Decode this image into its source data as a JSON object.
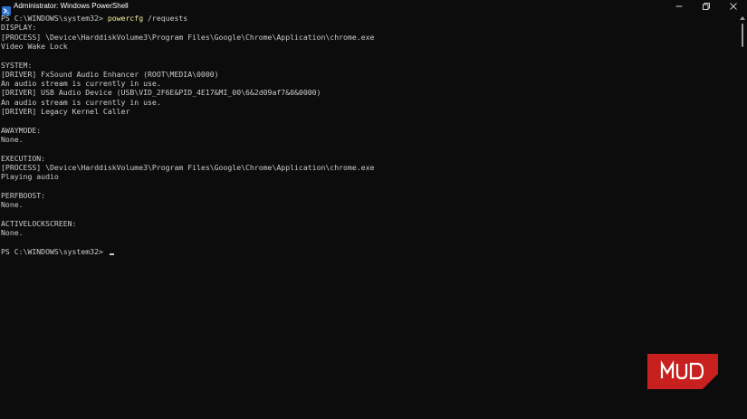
{
  "window": {
    "title": "Administrator: Windows PowerShell",
    "controls": {
      "minimize_icon": "minimize-icon",
      "maximize_icon": "restore-icon",
      "close_icon": "close-icon"
    }
  },
  "terminal": {
    "prompt": "PS C:\\WINDOWS\\system32> ",
    "command": "powercfg",
    "command_args": " /requests",
    "lines": [
      "DISPLAY:",
      "[PROCESS] \\Device\\HarddiskVolume3\\Program Files\\Google\\Chrome\\Application\\chrome.exe",
      "Video Wake Lock",
      "",
      "SYSTEM:",
      "[DRIVER] FxSound Audio Enhancer (ROOT\\MEDIA\\0000)",
      "An audio stream is currently in use.",
      "[DRIVER] USB Audio Device (USB\\VID_2F6E&PID_4E17&MI_00\\6&2d09af7&0&0000)",
      "An audio stream is currently in use.",
      "[DRIVER] Legacy Kernel Caller",
      "",
      "AWAYMODE:",
      "None.",
      "",
      "EXECUTION:",
      "[PROCESS] \\Device\\HarddiskVolume3\\Program Files\\Google\\Chrome\\Application\\chrome.exe",
      "Playing audio",
      "",
      "PERFBOOST:",
      "None.",
      "",
      "ACTIVELOCKSCREEN:",
      "None.",
      ""
    ],
    "final_prompt": "PS C:\\WINDOWS\\system32> "
  },
  "watermark": {
    "text": "MUO",
    "color": "#c8201e"
  },
  "colors": {
    "background": "#0c0c0c",
    "text": "#cccccc",
    "command": "#f9f1a5"
  }
}
